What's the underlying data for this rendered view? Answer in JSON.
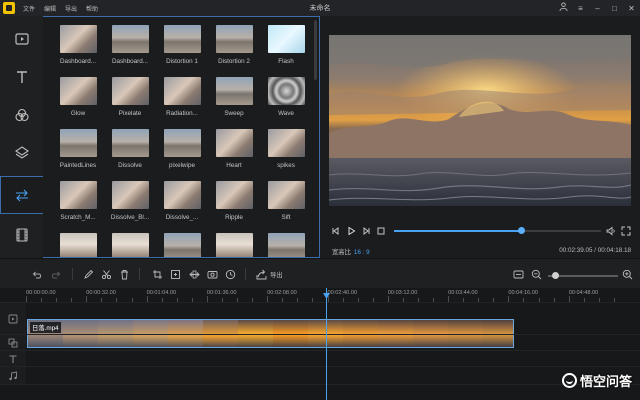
{
  "app": {
    "title": "未命名",
    "menu": [
      "文件",
      "编辑",
      "导出",
      "帮助"
    ],
    "window_controls": [
      "user-icon",
      "menu-icon",
      "minimize-icon",
      "maximize-icon",
      "close-icon"
    ]
  },
  "tools": [
    {
      "name": "media",
      "icon": "media-icon",
      "active": false
    },
    {
      "name": "text",
      "icon": "text-icon",
      "active": false
    },
    {
      "name": "filters",
      "icon": "filter-icon",
      "active": false
    },
    {
      "name": "overlays",
      "icon": "layers-icon",
      "active": false
    },
    {
      "name": "transitions",
      "icon": "transition-icon",
      "active": true
    },
    {
      "name": "elements",
      "icon": "film-icon",
      "active": false
    }
  ],
  "transitions": {
    "items": [
      {
        "label": "Dashboard...",
        "icon": "thumb-cat"
      },
      {
        "label": "Dashboard...",
        "icon": "thumb-road"
      },
      {
        "label": "Distortion 1",
        "icon": "thumb-road"
      },
      {
        "label": "Distortion 2",
        "icon": "thumb-road"
      },
      {
        "label": "Flash",
        "icon": "thumb-flash"
      },
      {
        "label": "Glow",
        "icon": "thumb-cat"
      },
      {
        "label": "Pixelate",
        "icon": "thumb-cat"
      },
      {
        "label": "Radiation...",
        "icon": "thumb-cat"
      },
      {
        "label": "Sweep",
        "icon": "thumb-road"
      },
      {
        "label": "Wave",
        "icon": "thumb-wave"
      },
      {
        "label": "PaintedLines",
        "icon": "thumb-road"
      },
      {
        "label": "Dissolve",
        "icon": "thumb-road"
      },
      {
        "label": "pixelwipe",
        "icon": "thumb-road"
      },
      {
        "label": "Heart",
        "icon": "thumb-cat"
      },
      {
        "label": "spikes",
        "icon": "thumb-cat"
      },
      {
        "label": "Scratch_M...",
        "icon": "thumb-cat"
      },
      {
        "label": "Dissolve_Bl...",
        "icon": "thumb-cat"
      },
      {
        "label": "Dissolve_...",
        "icon": "thumb-cat"
      },
      {
        "label": "Ripple",
        "icon": "thumb-cat"
      },
      {
        "label": "Sift",
        "icon": "thumb-cat"
      },
      {
        "label": "",
        "icon": "thumb-dog"
      },
      {
        "label": "",
        "icon": "thumb-dog"
      },
      {
        "label": "",
        "icon": "thumb-road"
      },
      {
        "label": "",
        "icon": "thumb-dog"
      },
      {
        "label": "",
        "icon": "thumb-road"
      }
    ]
  },
  "player": {
    "aspect_label": "宽高比",
    "aspect_value": "16 : 9",
    "current_time": "00:02:39.05",
    "total_time": "00:04:18.18",
    "progress": 0.615
  },
  "toolbar": {
    "icons": [
      "undo-icon",
      "redo-icon",
      "pen-icon",
      "cut-icon",
      "delete-icon",
      "crop-icon",
      "freeze-icon",
      "fit-icon",
      "record-icon",
      "speed-icon",
      "export-icon"
    ],
    "export_label": "导出",
    "zoom_level": 0.05
  },
  "timeline": {
    "ruler": [
      "00:00:00.00",
      "00:00:32.00",
      "00:01:04.00",
      "00:01:36.00",
      "00:02:08.00",
      "00:02:40.00",
      "00:03:12.00",
      "00:03:44.00",
      "00:04:16.00",
      "00:04:48.00"
    ],
    "clip_name": "日落.mp4",
    "tracks": [
      "video-track-icon",
      "overlay-track-icon",
      "text-track-icon",
      "music-track-icon"
    ]
  },
  "watermark": {
    "text": "悟空问答"
  },
  "colors": {
    "accent": "#4aa2f2",
    "panel_border": "#3b6ea8",
    "background": "#1b1c1e"
  }
}
